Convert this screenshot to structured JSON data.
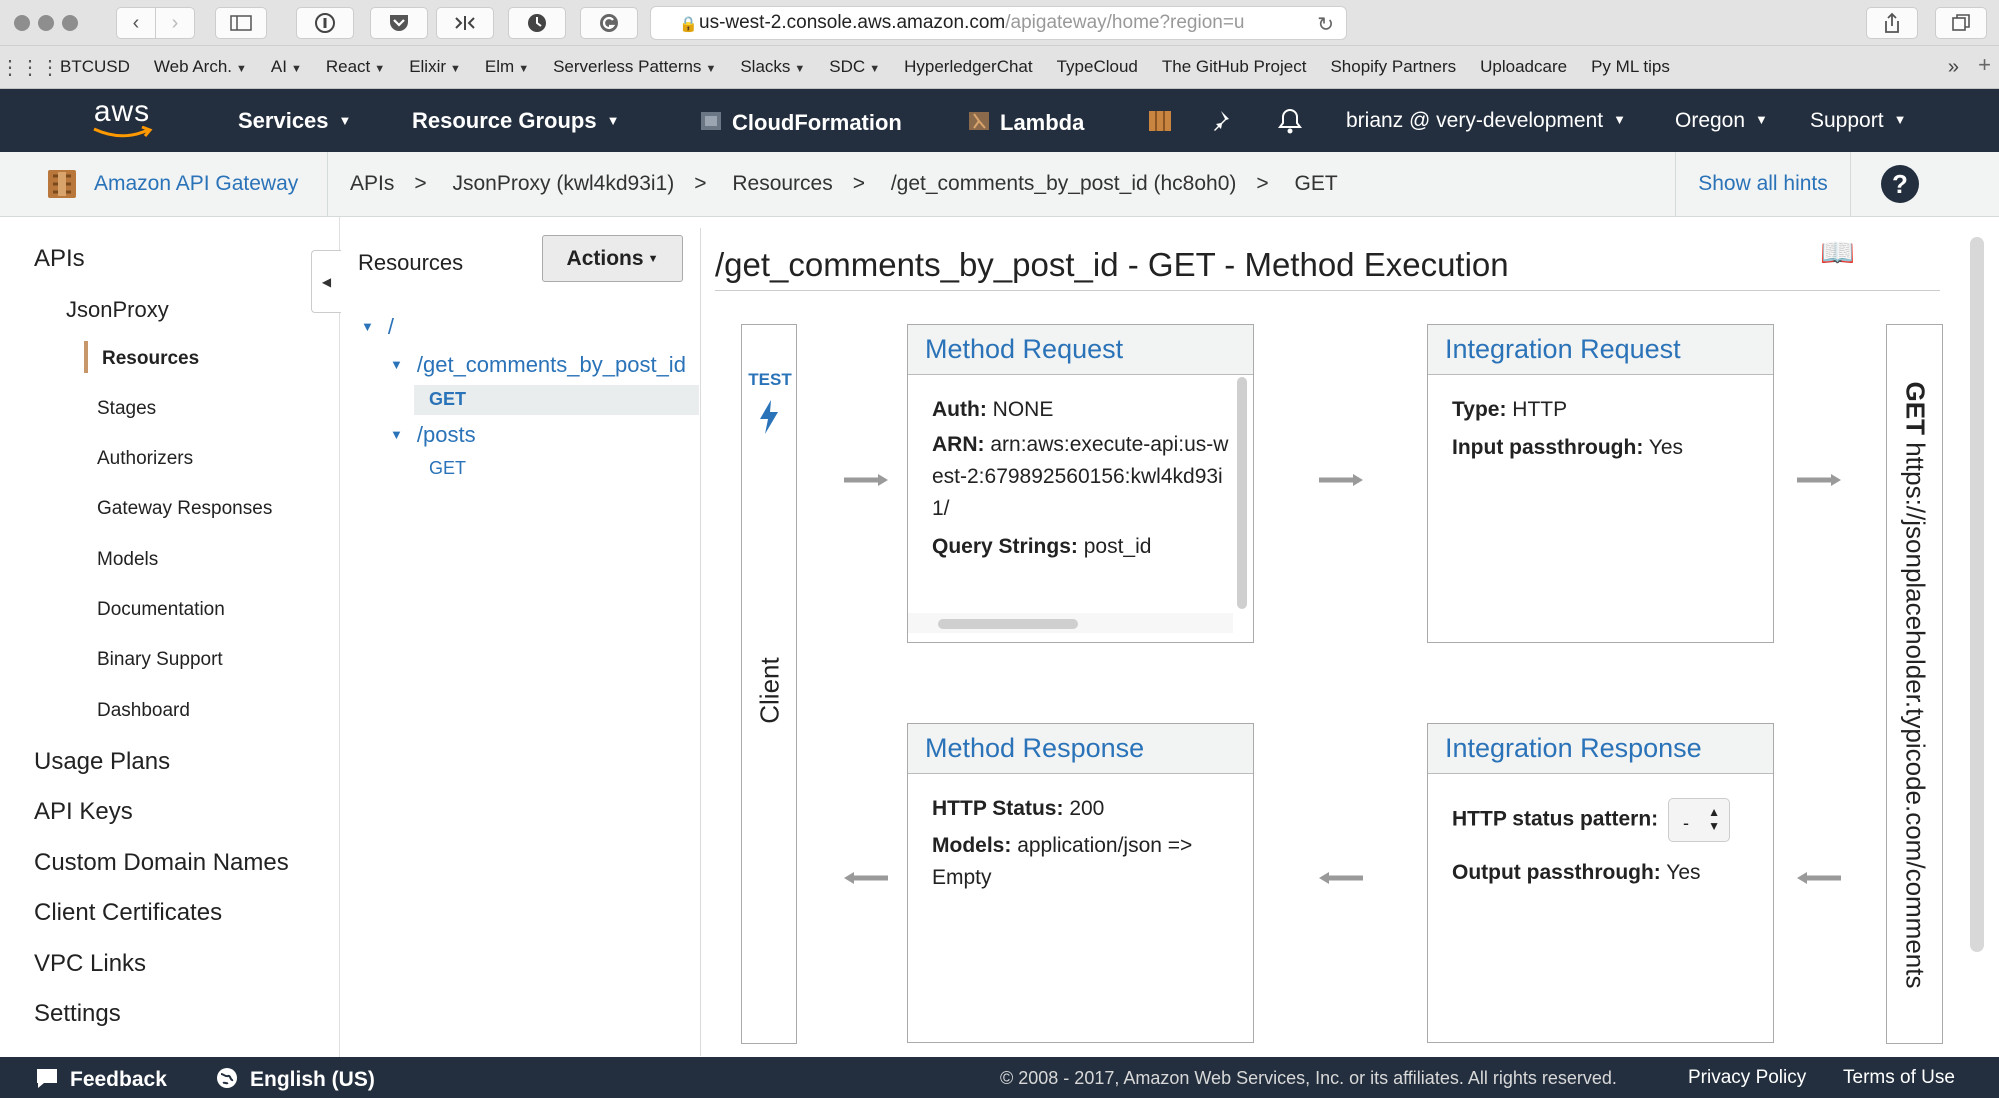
{
  "browser": {
    "url_domain": "us-west-2.console.aws.amazon.com",
    "url_rest": "/apigateway/home?region=u",
    "bookmarks": [
      {
        "label": "BTCUSD",
        "caret": false
      },
      {
        "label": "Web Arch.",
        "caret": true
      },
      {
        "label": "AI",
        "caret": true
      },
      {
        "label": "React",
        "caret": true
      },
      {
        "label": "Elixir",
        "caret": true
      },
      {
        "label": "Elm",
        "caret": true
      },
      {
        "label": "Serverless Patterns",
        "caret": true
      },
      {
        "label": "Slacks",
        "caret": true
      },
      {
        "label": "SDC",
        "caret": true
      },
      {
        "label": "HyperledgerChat",
        "caret": false
      },
      {
        "label": "TypeCloud",
        "caret": false
      },
      {
        "label": "The GitHub Project",
        "caret": false
      },
      {
        "label": "Shopify Partners",
        "caret": false
      },
      {
        "label": "Uploadcare",
        "caret": false
      },
      {
        "label": "Py ML tips",
        "caret": false
      }
    ],
    "more": "»"
  },
  "aws_nav": {
    "logo": "aws",
    "services": "Services",
    "resource_groups": "Resource Groups",
    "cloudformation": "CloudFormation",
    "lambda": "Lambda",
    "account": "brianz @ very-development",
    "region": "Oregon",
    "support": "Support"
  },
  "breadcrumb": {
    "service": "Amazon API Gateway",
    "items": [
      "APIs",
      "JsonProxy (kwl4kd93i1)",
      "Resources",
      "/get_comments_by_post_id (hc8oh0)",
      "GET"
    ],
    "separator": ">",
    "show_hints": "Show all hints",
    "help": "?"
  },
  "left_nav": {
    "apis": "APIs",
    "api_name": "JsonProxy",
    "items": [
      "Resources",
      "Stages",
      "Authorizers",
      "Gateway Responses",
      "Models",
      "Documentation",
      "Binary Support",
      "Dashboard"
    ],
    "top_items": [
      "Usage Plans",
      "API Keys",
      "Custom Domain Names",
      "Client Certificates",
      "VPC Links",
      "Settings"
    ]
  },
  "resources": {
    "title": "Resources",
    "actions": "Actions",
    "root": "/",
    "tree": [
      {
        "path": "/get_comments_by_post_id",
        "method": "GET",
        "selected": true
      },
      {
        "path": "/posts",
        "method": "GET",
        "selected": false
      }
    ]
  },
  "main": {
    "title": "/get_comments_by_post_id - GET - Method Execution",
    "test": "TEST",
    "client": "Client",
    "method_request": {
      "title": "Method Request",
      "auth_label": "Auth:",
      "auth_value": "NONE",
      "arn_label": "ARN:",
      "arn_value": "arn:aws:execute-api:us-west-2:679892560156:kwl4kd93i1/",
      "query_label": "Query Strings:",
      "query_value": "post_id"
    },
    "integration_request": {
      "title": "Integration Request",
      "type_label": "Type:",
      "type_value": "HTTP",
      "passthrough_label": "Input passthrough:",
      "passthrough_value": "Yes"
    },
    "method_response": {
      "title": "Method Response",
      "status_label": "HTTP Status:",
      "status_value": "200",
      "models_label": "Models:",
      "models_value": "application/json => Empty"
    },
    "integration_response": {
      "title": "Integration Response",
      "pattern_label": "HTTP status pattern:",
      "pattern_value": "-",
      "passthrough_label": "Output passthrough:",
      "passthrough_value": "Yes"
    },
    "endpoint_method": "GET",
    "endpoint_url": "https://jsonplaceholder.typicode.com/comments"
  },
  "footer": {
    "feedback": "Feedback",
    "language": "English (US)",
    "copyright": "© 2008 - 2017, Amazon Web Services, Inc. or its affiliates. All rights reserved.",
    "privacy": "Privacy Policy",
    "terms": "Terms of Use"
  },
  "colors": {
    "aws_nav_bg": "#232f3e",
    "link_blue": "#2a73b8",
    "active_marker": "#c7966a"
  }
}
